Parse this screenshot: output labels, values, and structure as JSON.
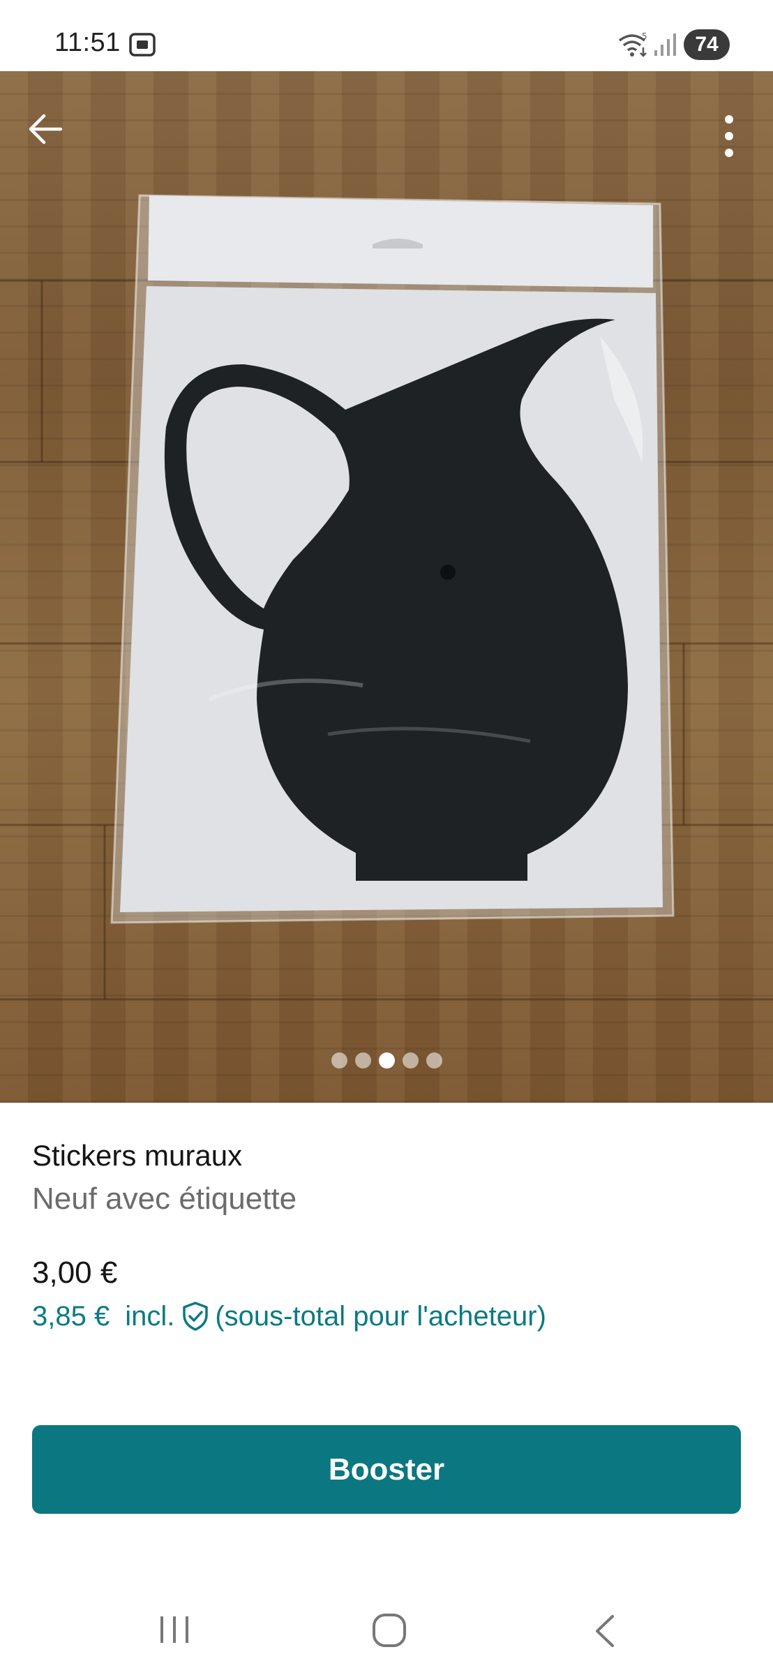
{
  "status_bar": {
    "time": "11:51",
    "battery": "74",
    "icons": [
      "screenshot-icon",
      "wifi-icon",
      "signal-icon"
    ]
  },
  "hero": {
    "carousel": {
      "count": 5,
      "active_index": 2
    },
    "icons": [
      "back-arrow-icon",
      "more-vertical-icon"
    ]
  },
  "listing": {
    "title": "Stickers muraux",
    "condition": "Neuf avec étiquette",
    "price": "3,00 €",
    "buyer_price": "3,85 €",
    "buyer_incl": "incl.",
    "buyer_note": "(sous-total pour l'acheteur)"
  },
  "actions": {
    "booster_label": "Booster"
  },
  "colors": {
    "accent": "#0b7781",
    "accent_text": "#0a7a83"
  },
  "nav_bar": {
    "icons": [
      "recents-icon",
      "home-icon",
      "back-icon"
    ]
  }
}
